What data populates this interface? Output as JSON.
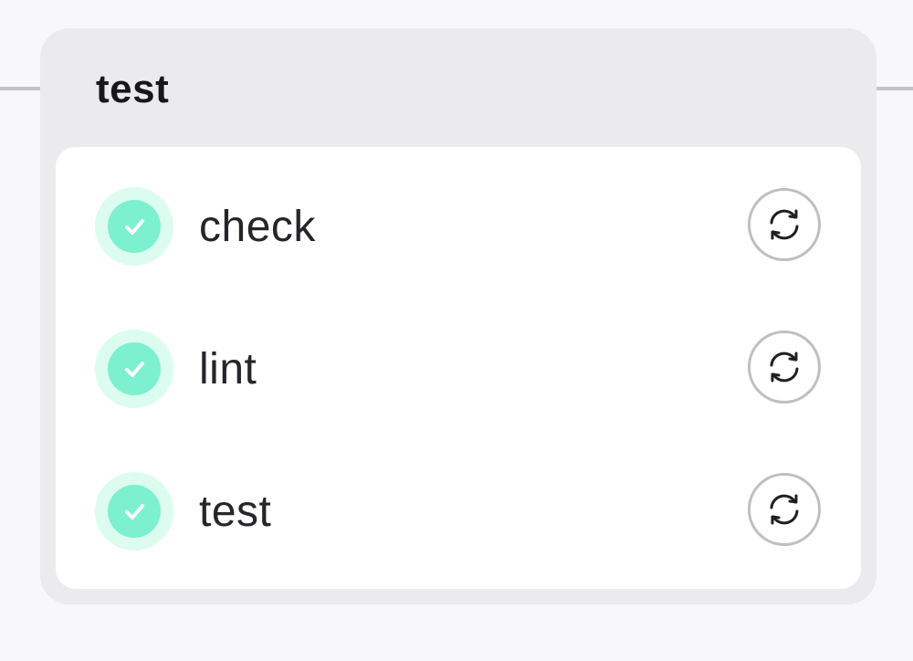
{
  "stage": {
    "title": "test",
    "jobs": [
      {
        "name": "check",
        "status": "passed",
        "status_icon": "check-icon",
        "action_icon": "retry-icon"
      },
      {
        "name": "lint",
        "status": "passed",
        "status_icon": "check-icon",
        "action_icon": "retry-icon"
      },
      {
        "name": "test",
        "status": "passed",
        "status_icon": "check-icon",
        "action_icon": "retry-icon"
      }
    ]
  },
  "colors": {
    "success": "#7cf0cf",
    "success_halo": "#dcfcf0",
    "card_bg": "#ebebee",
    "text": "#26262a"
  }
}
